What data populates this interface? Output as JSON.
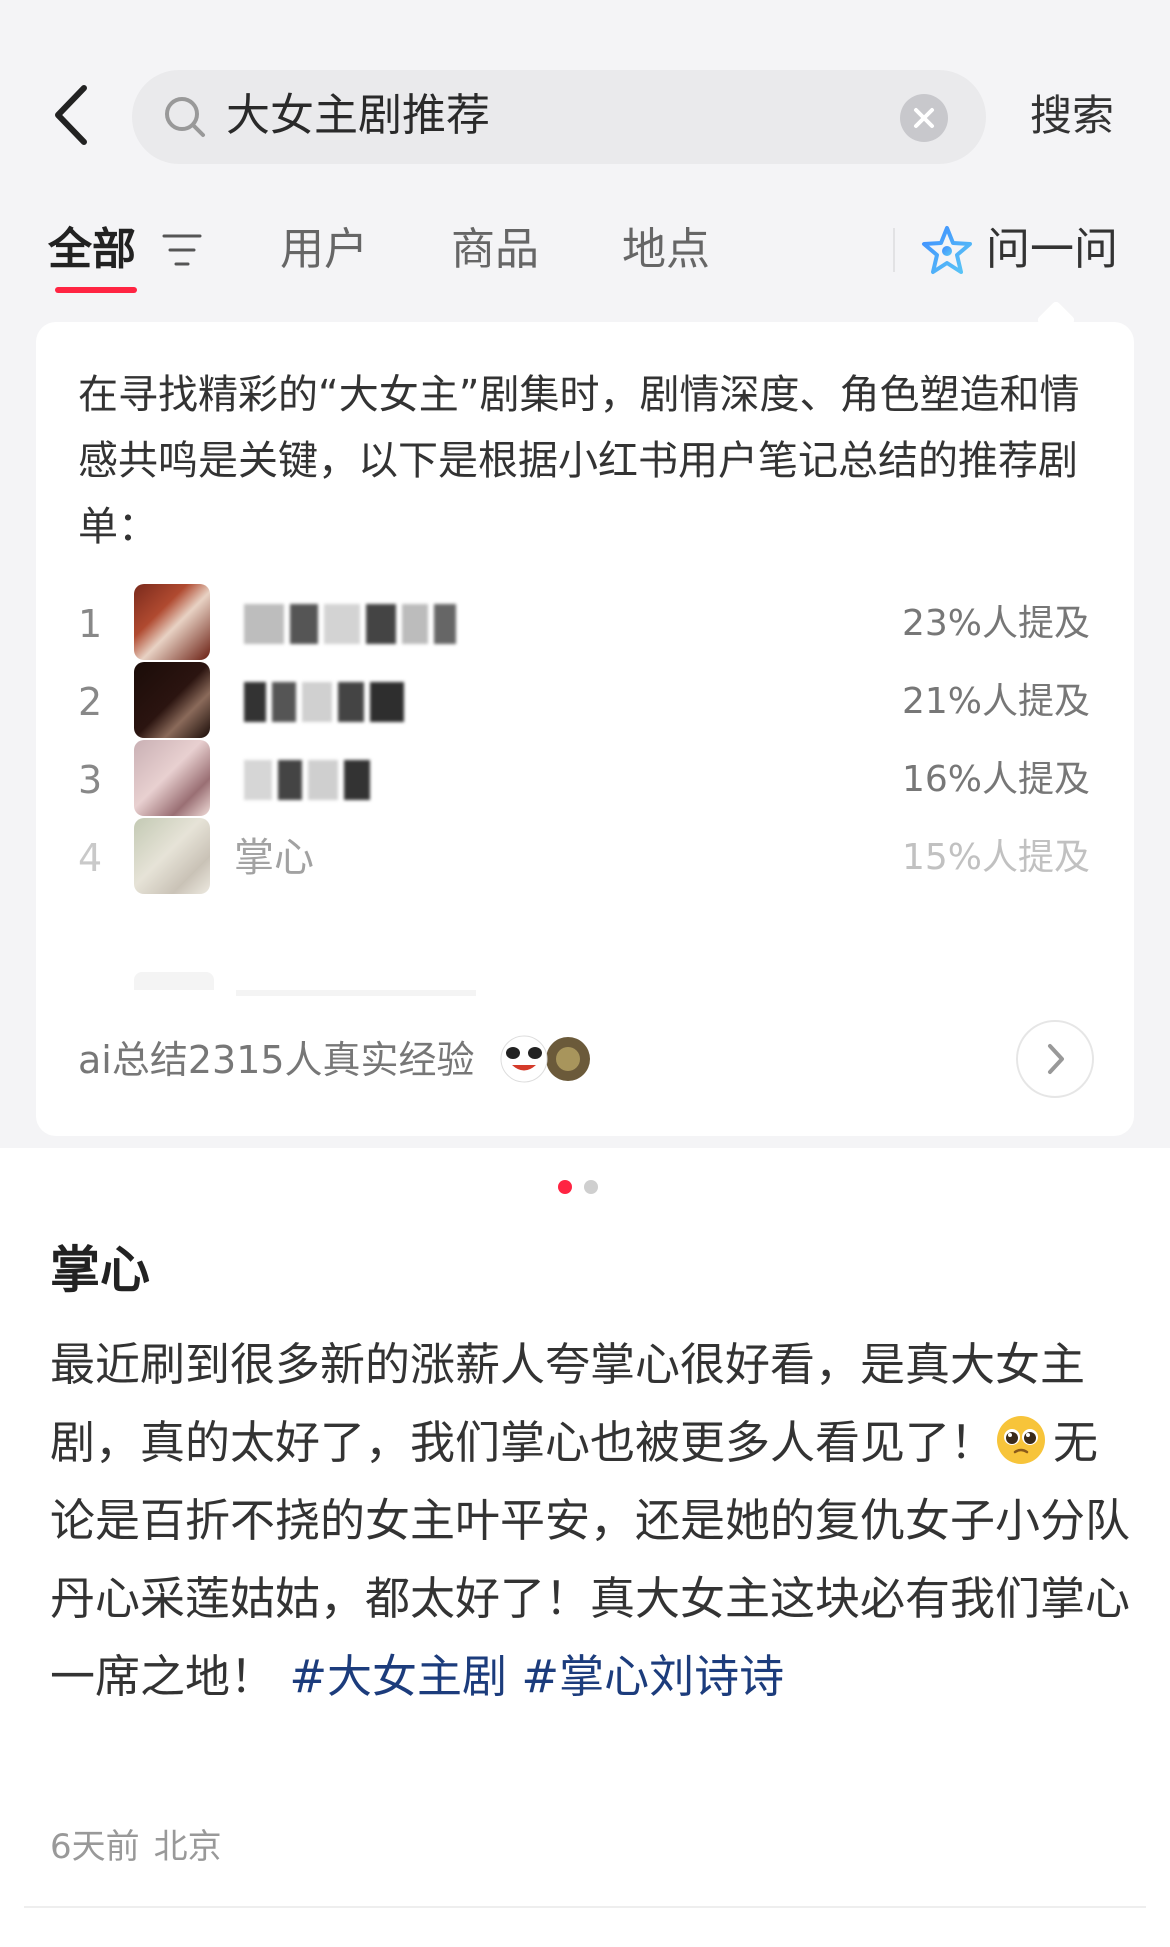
{
  "search": {
    "back_icon": "chevron-left-icon",
    "search_icon": "search-icon",
    "query": "大女主剧推荐",
    "clear_icon": "close-icon",
    "submit_label": "搜索"
  },
  "tabs": {
    "items": [
      {
        "label": "全部",
        "active": true
      },
      {
        "label": "用户",
        "active": false
      },
      {
        "label": "商品",
        "active": false
      },
      {
        "label": "地点",
        "active": false
      }
    ],
    "filter_icon": "filter-icon",
    "ask_label": "问一问",
    "ask_icon": "sparkle-star-icon",
    "accent_color": "#ff2442"
  },
  "ai_card": {
    "intro": "在寻找精彩的“大女主”剧集时，剧情深度、角色塑造和情感共鸣是关键，以下是根据小红书用户笔记总结的推荐剧单：",
    "ranking": [
      {
        "rank": "1",
        "title": "",
        "mention": "23%人提及",
        "title_blurred": true
      },
      {
        "rank": "2",
        "title": "",
        "mention": "21%人提及",
        "title_blurred": true
      },
      {
        "rank": "3",
        "title": "",
        "mention": "16%人提及",
        "title_blurred": true
      },
      {
        "rank": "4",
        "title": "掌心",
        "mention": "15%人提及",
        "title_blurred": false
      }
    ],
    "summary": "ai总结2315人真实经验",
    "more_icon": "chevron-right-icon"
  },
  "pagination": {
    "total": 2,
    "current": 1,
    "active_color": "#ff2442",
    "inactive_color": "#cfcfcf"
  },
  "post": {
    "title": "掌心",
    "body_part1": "最近刷到很多新的涨薪人夸掌心很好看，是真大女主剧，真的太好了，我们掌心也被更多人看见了！",
    "emoji": "pleading-face-emoji",
    "body_part2": "无论是百折不挠的女主叶平安，还是她的复仇女子小分队丹心采莲姑姑，都太好了！真大女主这块必有我们掌心一席之地！",
    "hashtags": [
      "#大女主剧",
      "#掌心刘诗诗"
    ],
    "hashtag_color": "#1c3c7c",
    "time": "6天前",
    "location": "北京"
  }
}
